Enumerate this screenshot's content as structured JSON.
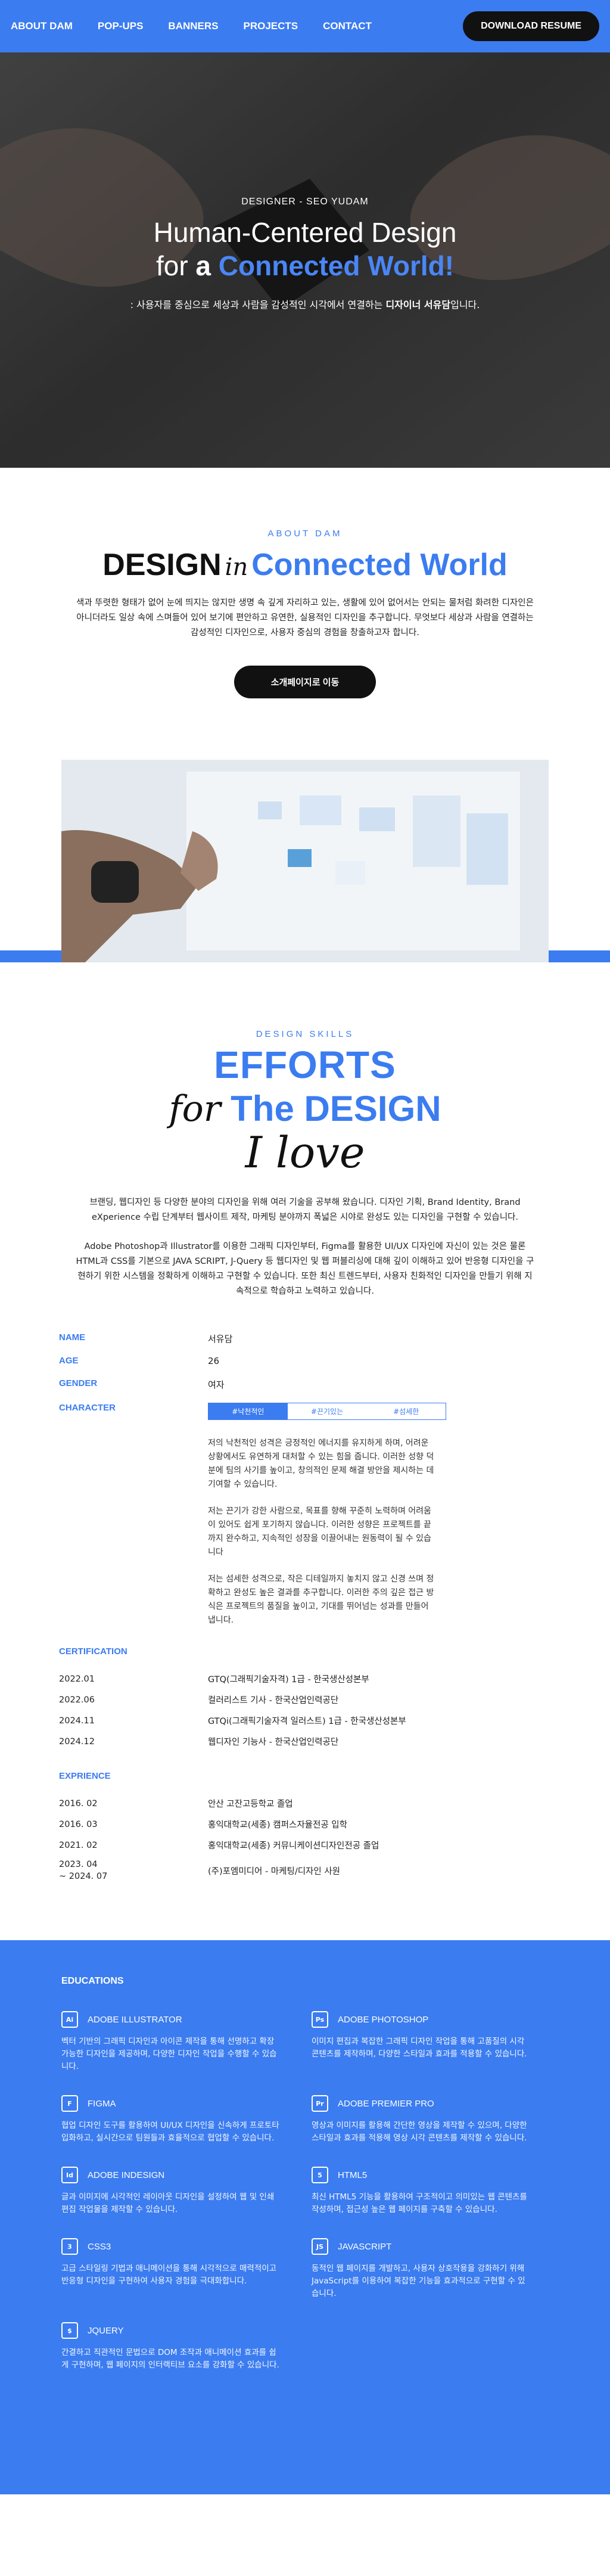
{
  "nav": {
    "links": [
      "ABOUT DAM",
      "POP-UPS",
      "BANNERS",
      "PROJECTS",
      "CONTACT"
    ],
    "cta": "DOWNLOAD RESUME"
  },
  "hero": {
    "kicker": "DESIGNER - SEO YUDAM",
    "title1": "Human-Centered Design",
    "title2_for": "for",
    "title2_a": "a",
    "title2_cw": "Connected World!",
    "sub_pre": ": 사용자를 중심으로 세상과 사람을 감성적인 시각에서 연결하는 ",
    "sub_bold": "디자이너 서유담",
    "sub_post": "입니다."
  },
  "about": {
    "kicker": "ABOUT DAM",
    "title_design": "DESIGN",
    "title_in": "in",
    "title_cw": "Connected World",
    "text": "색과 뚜렷한 형태가 없어 눈에 띄지는 않지만 생명 속 깊게 자리하고 있는, 생활에 있어 없어서는 안되는 물처럼 화려한 디자인은 아니더라도 일상 속에 스며들어 있어 보기에 편안하고 유연한, 실용적인 디자인을 추구합니다. 무엇보다 세상과 사람을 연결하는 감성적인 디자인으로, 사용자 중심의 경험을 창출하고자 합니다.",
    "button": "소개페이지로 이동"
  },
  "skills": {
    "kicker": "DESIGN SKILLS",
    "efforts": "EFFORTS",
    "for": "for",
    "the_design": "The DESIGN",
    "ilove": "I love",
    "para1": "브랜딩, 웹디자인 등 다양한 분야의 디자인을 위해 여러 기술을 공부해 왔습니다. 디자인 기획, Brand Identity, Brand eXperience 수립 단계부터 웹사이트 제작, 마케팅 분야까지 폭넓은 시야로 완성도 있는 디자인을 구현할 수 있습니다.",
    "para2": "Adobe Photoshop과 Illustrator를 이용한 그래픽 디자인부터, Figma를 활용한 UI/UX 디자인에 자신이 있는 것은 물론 HTML과 CSS를 기본으로 JAVA SCRIPT, J-Query 등 웹디자인 및 웹 퍼블리싱에 대해 깊이 이해하고 있어 반응형 디자인을 구현하기 위한 시스템을 정확하게 이해하고 구현할 수 있습니다. 또한 최신 트렌드부터, 사용자 친화적인 디자인을 만들기 위해 지속적으로 학습하고 노력하고 있습니다."
  },
  "profile": {
    "name_label": "NAME",
    "name": "서유담",
    "age_label": "AGE",
    "age": "26",
    "gender_label": "GENDER",
    "gender": "여자",
    "character_label": "CHARACTER",
    "tags": [
      "#낙천적인",
      "#끈기있는",
      "#섬세한"
    ],
    "char1": "저의 낙천적인 성격은 긍정적인 에너지를 유지하게 하며, 어려운 상황에서도 유연하게 대처할 수 있는 힘을 줍니다. 이러한 성향 덕분에 팀의 사기를 높이고, 창의적인 문제 해결 방안을 제시하는 데 기여할 수 있습니다.",
    "char2": "저는 끈기가 강한 사람으로, 목표를 향해 꾸준히 노력하며 어려움이 있어도 쉽게 포기하지 않습니다. 이러한 성향은 프로젝트를 끝까지 완수하고, 지속적인 성장을 이끌어내는 원동력이 될 수 있습니다",
    "char3": "저는 섬세한 성격으로, 작은 디테일까지 놓치지 않고 신경 쓰며 정확하고 완성도 높은 결과를 추구합니다. 이러한 주의 깊은 접근 방식은 프로젝트의 품질을 높이고, 기대를 뛰어넘는 성과를 만들어냅니다."
  },
  "certification": {
    "label": "CERTIFICATION",
    "items": [
      {
        "date": "2022.01",
        "text": "GTQ(그래픽기술자격) 1급 - 한국생산성본부"
      },
      {
        "date": "2022.06",
        "text": "컬러리스트 기사 - 한국산업인력공단"
      },
      {
        "date": "2024.11",
        "text": "GTQi(그래픽기술자격 일러스트) 1급 - 한국생산성본부"
      },
      {
        "date": "2024.12",
        "text": "웹디자인 기능사 - 한국산업인력공단"
      }
    ]
  },
  "experience": {
    "label": "EXPRIENCE",
    "items": [
      {
        "date": "2016. 02",
        "text": "안산 고잔고등학교 졸업"
      },
      {
        "date": "2016. 03",
        "text": "홍익대학교(세종) 캠퍼스자율전공 입학"
      },
      {
        "date": "2021. 02",
        "text": "홍익대학교(세종) 커뮤니케이션디자인전공 졸업"
      },
      {
        "date": "2023. 04\n~  2024. 07",
        "text": "(주)포엠미디어 - 마케팅/디자인 사원"
      }
    ]
  },
  "educations": {
    "title": "EDUCATIONS",
    "items": [
      {
        "icon": "Ai",
        "name": "ADOBE ILLUSTRATOR",
        "desc": "벡터 기반의 그래픽 디자인과 아이콘 제작을 통해 선명하고 확장 가능한 디자인을 제공하며, 다양한 디자인 작업을 수행할 수 있습니다."
      },
      {
        "icon": "Ps",
        "name": "ADOBE PHOTOSHOP",
        "desc": "이미지 편집과 복잡한 그래픽 디자인 작업을 통해 고품질의 시각 콘텐츠를 제작하며, 다양한 스타일과 효과를 적용할 수 있습니다."
      },
      {
        "icon": "F",
        "name": "FIGMA",
        "desc": "협업 디자인 도구를 활용하여 UI/UX 디자인을 신속하게 프로토타입화하고, 실시간으로 팀원들과 효율적으로 협업할 수 있습니다."
      },
      {
        "icon": "Pr",
        "name": "ADOBE PREMIER PRO",
        "desc": "영상과 이미지를 활용해 간단한 영상을 제작할 수 있으며, 다양한 스타일과 효과를 적용해 영상 시각 콘텐츠를 제작할 수 있습니다."
      },
      {
        "icon": "Id",
        "name": "ADOBE INDESIGN",
        "desc": "글과 이미지에 시각적인 레이아웃 디자인을 설정하여 웹 및 인쇄 편집 작업물을 제작할 수 있습니다."
      },
      {
        "icon": "5",
        "name": "HTML5",
        "desc": "최신 HTML5 기능을 활용하여 구조적이고 의미있는 웹 콘텐츠를 작성하며, 접근성 높은 웹 페이지를 구축할 수 있습니다."
      },
      {
        "icon": "3",
        "name": "CSS3",
        "desc": "고급 스타일링 기법과 애니메이션을 통해 시각적으로 매력적이고 반응형 디자인을 구현하여 사용자 경험을 극대화합니다."
      },
      {
        "icon": "JS",
        "name": "JAVASCRIPT",
        "desc": "동적인 웹 페이지를 개발하고, 사용자 상호작용을 강화하기 위해 JavaScript를 이용하여 복잡한 기능을 효과적으로 구현할 수 있습니다."
      },
      {
        "icon": "$",
        "name": "JQUERY",
        "desc": "간결하고 직관적인 문법으로 DOM 조작과 애니메이션 효과를 쉽게 구현하며, 웹 페이지의 인터랙티브 요소를 강화할 수 있습니다."
      }
    ]
  },
  "colors": {
    "accent": "#3b7cf0",
    "dark": "#111111"
  }
}
